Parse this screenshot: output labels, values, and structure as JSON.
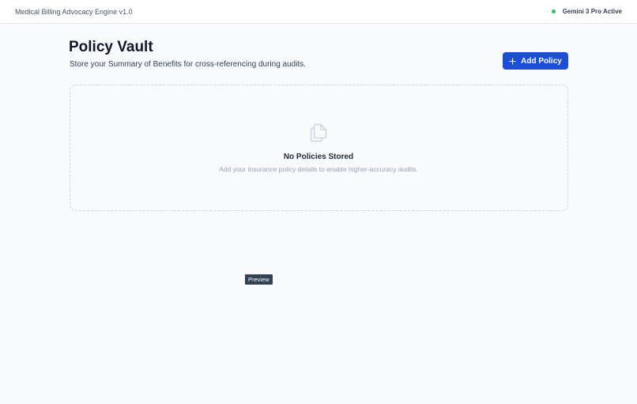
{
  "app": {
    "title": "Medical Billing Advocacy Engine v1.0",
    "status_label": "Gemini 3 Pro Active",
    "status_color": "#22c55e"
  },
  "header": {
    "title": "Policy Vault",
    "subtitle": "Store your Summary of Benefits for cross-referencing during audits.",
    "add_button": {
      "label": "Add Policy",
      "icon": "plus-icon"
    }
  },
  "empty_state": {
    "icon": "document-copy-icon",
    "title": "No Policies Stored",
    "description": "Add your insurance policy details to enable higher-accuracy audits."
  },
  "tooltip": {
    "label": "Preview"
  },
  "colors": {
    "accent": "#1d4ed8",
    "background": "#f8fafc",
    "status_dot": "#22c55e"
  }
}
